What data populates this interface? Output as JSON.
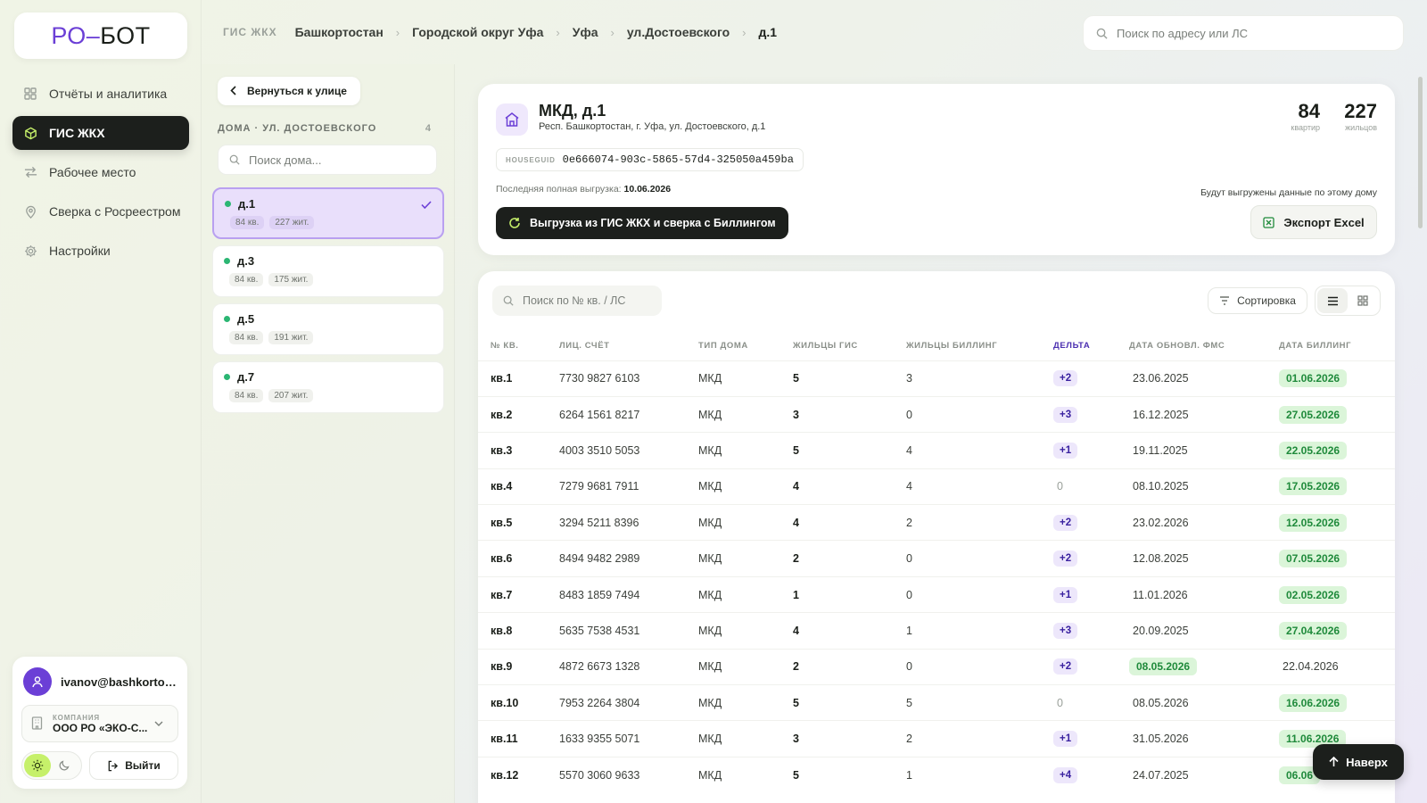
{
  "logo": {
    "ro": "РО",
    "dash": "–",
    "bot": "БОТ"
  },
  "nav": {
    "items": [
      {
        "label": "Отчёты и аналитика",
        "icon": "grid-icon"
      },
      {
        "label": "ГИС ЖКХ",
        "icon": "cube-icon",
        "active": true
      },
      {
        "label": "Рабочее место",
        "icon": "swap-icon"
      },
      {
        "label": "Сверка с Росреестром",
        "icon": "pin-icon"
      },
      {
        "label": "Настройки",
        "icon": "gear-icon"
      }
    ]
  },
  "user": {
    "email": "ivanov@bashkortost...",
    "company_label": "КОМПАНИЯ",
    "company_name": "ООО РО «ЭКО-С...",
    "logout_label": "Выйти"
  },
  "breadcrumbs": [
    "ГИС ЖКХ",
    "Башкортостан",
    "Городской округ Уфа",
    "Уфа",
    "ул.Достоевского",
    "д.1"
  ],
  "top_search": {
    "placeholder": "Поиск по адресу или ЛС"
  },
  "houses_panel": {
    "back_label": "Вернуться к улице",
    "heading": "ДОМА · УЛ. ДОСТОЕВСКОГО",
    "count": "4",
    "search_placeholder": "Поиск дома...",
    "houses": [
      {
        "name": "д.1",
        "apts": "84 кв.",
        "residents": "227 жит.",
        "active": true
      },
      {
        "name": "д.3",
        "apts": "84 кв.",
        "residents": "175 жит."
      },
      {
        "name": "д.5",
        "apts": "84 кв.",
        "residents": "191 жит."
      },
      {
        "name": "д.7",
        "apts": "84 кв.",
        "residents": "207 жит."
      }
    ]
  },
  "house": {
    "title": "МКД, д.1",
    "address": "Респ. Башкортостан, г. Уфа, ул. Достоевского, д.1",
    "guid_label": "HOUSEGUID",
    "guid": "0e666074-903c-5865-57d4-325050a459ba",
    "last_export_label": "Последняя полная выгрузка:",
    "last_export_date": "10.06.2026",
    "sync_label": "Выгрузка из ГИС ЖКХ и сверка с Биллингом",
    "apartments": "84",
    "apartments_label": "квартир",
    "residents": "227",
    "residents_label": "жильцов",
    "export_note": "Будут выгружены данные по этому дому",
    "excel_label": "Экспорт Excel"
  },
  "table": {
    "search_placeholder": "Поиск по № кв. / ЛС",
    "sort_label": "Сортировка",
    "headers": [
      "№ КВ.",
      "ЛИЦ. СЧЁТ",
      "ТИП ДОМА",
      "ЖИЛЬЦЫ ГИС",
      "ЖИЛЬЦЫ БИЛЛИНГ",
      "ДЕЛЬТА",
      "ДАТА ОБНОВЛ. ФМС",
      "ДАТА БИЛЛИНГ"
    ],
    "rows": [
      {
        "apt": "кв.1",
        "account": "7730 9827 6103",
        "type": "МКД",
        "gis": "5",
        "billing": "3",
        "delta": "+2",
        "fms": "23.06.2025",
        "bill_date": "01.06.2026",
        "hl": "bill"
      },
      {
        "apt": "кв.2",
        "account": "6264 1561 8217",
        "type": "МКД",
        "gis": "3",
        "billing": "0",
        "delta": "+3",
        "fms": "16.12.2025",
        "bill_date": "27.05.2026",
        "hl": "bill"
      },
      {
        "apt": "кв.3",
        "account": "4003 3510 5053",
        "type": "МКД",
        "gis": "5",
        "billing": "4",
        "delta": "+1",
        "fms": "19.11.2025",
        "bill_date": "22.05.2026",
        "hl": "bill"
      },
      {
        "apt": "кв.4",
        "account": "7279 9681 7911",
        "type": "МКД",
        "gis": "4",
        "billing": "4",
        "delta": "0",
        "fms": "08.10.2025",
        "bill_date": "17.05.2026",
        "hl": "bill"
      },
      {
        "apt": "кв.5",
        "account": "3294 5211 8396",
        "type": "МКД",
        "gis": "4",
        "billing": "2",
        "delta": "+2",
        "fms": "23.02.2026",
        "bill_date": "12.05.2026",
        "hl": "bill"
      },
      {
        "apt": "кв.6",
        "account": "8494 9482 2989",
        "type": "МКД",
        "gis": "2",
        "billing": "0",
        "delta": "+2",
        "fms": "12.08.2025",
        "bill_date": "07.05.2026",
        "hl": "bill"
      },
      {
        "apt": "кв.7",
        "account": "8483 1859 7494",
        "type": "МКД",
        "gis": "1",
        "billing": "0",
        "delta": "+1",
        "fms": "11.01.2026",
        "bill_date": "02.05.2026",
        "hl": "bill"
      },
      {
        "apt": "кв.8",
        "account": "5635 7538 4531",
        "type": "МКД",
        "gis": "4",
        "billing": "1",
        "delta": "+3",
        "fms": "20.09.2025",
        "bill_date": "27.04.2026",
        "hl": "bill"
      },
      {
        "apt": "кв.9",
        "account": "4872 6673 1328",
        "type": "МКД",
        "gis": "2",
        "billing": "0",
        "delta": "+2",
        "fms": "08.05.2026",
        "bill_date": "22.04.2026",
        "hl": "fms"
      },
      {
        "apt": "кв.10",
        "account": "7953 2264 3804",
        "type": "МКД",
        "gis": "5",
        "billing": "5",
        "delta": "0",
        "fms": "08.05.2026",
        "bill_date": "16.06.2026",
        "hl": "bill"
      },
      {
        "apt": "кв.11",
        "account": "1633 9355 5071",
        "type": "МКД",
        "gis": "3",
        "billing": "2",
        "delta": "+1",
        "fms": "31.05.2026",
        "bill_date": "11.06.2026",
        "hl": "bill"
      },
      {
        "apt": "кв.12",
        "account": "5570 3060 9633",
        "type": "МКД",
        "gis": "5",
        "billing": "1",
        "delta": "+4",
        "fms": "24.07.2025",
        "bill_date": "06.06",
        "hl": "bill"
      }
    ]
  },
  "to_top_label": "Наверх",
  "colors": {
    "accent": "#6b3fd6",
    "lime": "#c6f06a",
    "dark": "#1c1f1c",
    "green": "#1f8a3b"
  }
}
